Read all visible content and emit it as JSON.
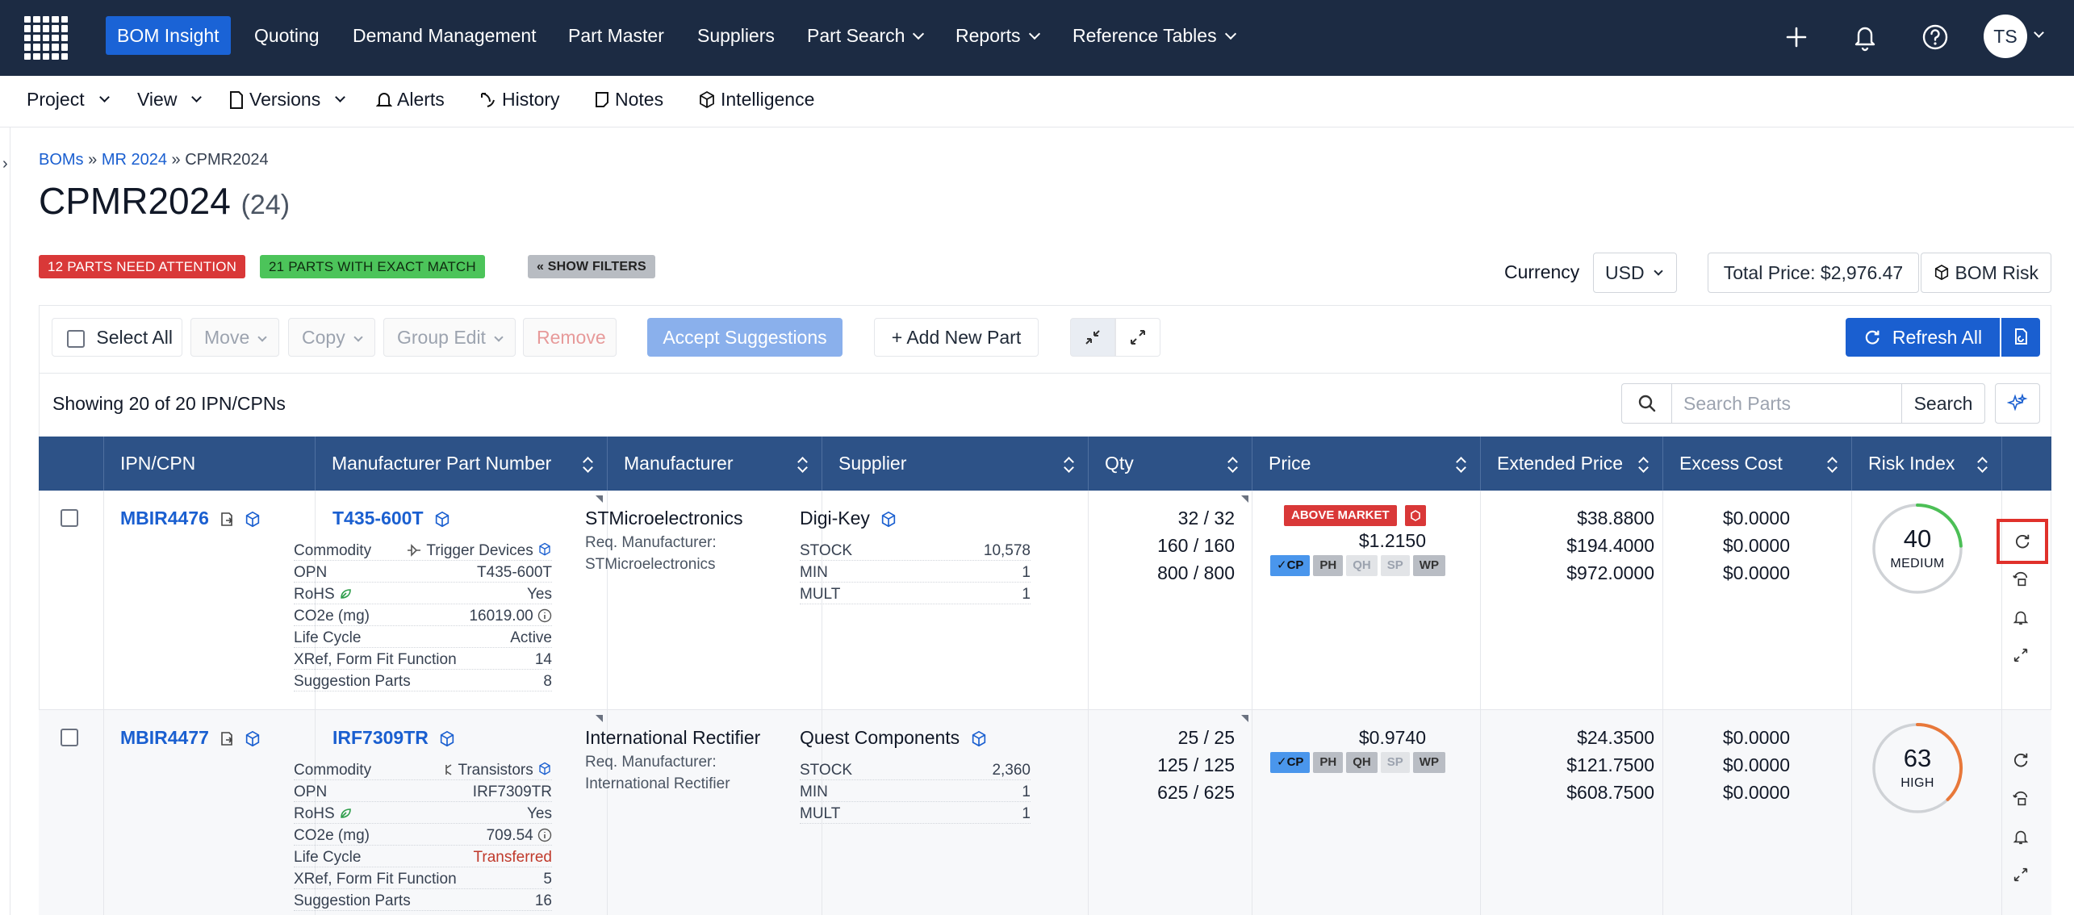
{
  "nav": {
    "items": [
      "BOM Insight",
      "Quoting",
      "Demand Management",
      "Part Master",
      "Suppliers",
      "Part Search",
      "Reports",
      "Reference Tables"
    ],
    "avatar_initials": "TS"
  },
  "subnav": [
    "Project",
    "View",
    "Versions",
    "Alerts",
    "History",
    "Notes",
    "Intelligence"
  ],
  "breadcrumb": {
    "root": "BOMs",
    "sep": "»",
    "parent": "MR 2024",
    "current": "CPMR2024"
  },
  "title": {
    "name": "CPMR2024",
    "count": "(24)"
  },
  "badges": {
    "attention": "12 PARTS NEED ATTENTION",
    "exact": "21 PARTS WITH EXACT MATCH",
    "filters": "« SHOW FILTERS"
  },
  "currency": {
    "label": "Currency",
    "value": "USD"
  },
  "total_price": "Total Price: $2,976.47",
  "bom_risk": "BOM Risk",
  "toolbar": {
    "select_all": "Select All",
    "move": "Move",
    "copy": "Copy",
    "group_edit": "Group Edit",
    "remove": "Remove",
    "accept": "Accept Suggestions",
    "add": "Add New Part",
    "refresh": "Refresh All"
  },
  "showing": "Showing 20 of 20 IPN/CPNs",
  "search": {
    "placeholder": "Search Parts",
    "button": "Search"
  },
  "columns": [
    "IPN/CPN",
    "Manufacturer Part Number",
    "Manufacturer",
    "Supplier",
    "Qty",
    "Price",
    "Extended Price",
    "Excess Cost",
    "Risk Index"
  ],
  "rows": [
    {
      "ipn": "MBIR4476",
      "mpn": "T435-600T",
      "attrs": [
        {
          "k": "Commodity",
          "v": "Trigger Devices"
        },
        {
          "k": "OPN",
          "v": "T435-600T"
        },
        {
          "k": "RoHS",
          "v": "Yes"
        },
        {
          "k": "CO2e (mg)",
          "v": "16019.00"
        },
        {
          "k": "Life Cycle",
          "v": "Active"
        },
        {
          "k": "XRef, Form Fit Function",
          "v": "14"
        },
        {
          "k": "Suggestion Parts",
          "v": "8"
        }
      ],
      "manufacturer": "STMicroelectronics",
      "req_mfr_label": "Req. Manufacturer:",
      "req_mfr": "STMicroelectronics",
      "supplier": "Digi-Key",
      "stock": [
        {
          "k": "STOCK",
          "v": "10,578"
        },
        {
          "k": "MIN",
          "v": "1"
        },
        {
          "k": "MULT",
          "v": "1"
        }
      ],
      "qty": [
        "32 / 32",
        "160 / 160",
        "800 / 800"
      ],
      "above_market": "ABOVE MARKET",
      "price": "$1.2150",
      "pills": [
        "CP",
        "PH",
        "QH",
        "SP",
        "WP"
      ],
      "extended": [
        "$38.8800",
        "$194.4000",
        "$972.0000"
      ],
      "excess": [
        "$0.0000",
        "$0.0000",
        "$0.0000"
      ],
      "risk": {
        "value": 40,
        "label": "MEDIUM",
        "color": "#4cbf56"
      }
    },
    {
      "ipn": "MBIR4477",
      "mpn": "IRF7309TR",
      "attrs": [
        {
          "k": "Commodity",
          "v": "Transistors"
        },
        {
          "k": "OPN",
          "v": "IRF7309TR"
        },
        {
          "k": "RoHS",
          "v": "Yes"
        },
        {
          "k": "CO2e (mg)",
          "v": "709.54"
        },
        {
          "k": "Life Cycle",
          "v": "Transferred"
        },
        {
          "k": "XRef, Form Fit Function",
          "v": "5"
        },
        {
          "k": "Suggestion Parts",
          "v": "16"
        }
      ],
      "manufacturer": "International Rectifier",
      "req_mfr_label": "Req. Manufacturer:",
      "req_mfr": "International Rectifier",
      "supplier": "Quest Components",
      "stock": [
        {
          "k": "STOCK",
          "v": "2,360"
        },
        {
          "k": "MIN",
          "v": "1"
        },
        {
          "k": "MULT",
          "v": "1"
        }
      ],
      "qty": [
        "25 / 25",
        "125 / 125",
        "625 / 625"
      ],
      "price": "$0.9740",
      "pills": [
        "CP",
        "PH",
        "QH",
        "SP",
        "WP"
      ],
      "extended": [
        "$24.3500",
        "$121.7500",
        "$608.7500"
      ],
      "excess": [
        "$0.0000",
        "$0.0000",
        "$0.0000"
      ],
      "risk": {
        "value": 63,
        "label": "HIGH",
        "color": "#e8783a"
      }
    }
  ]
}
